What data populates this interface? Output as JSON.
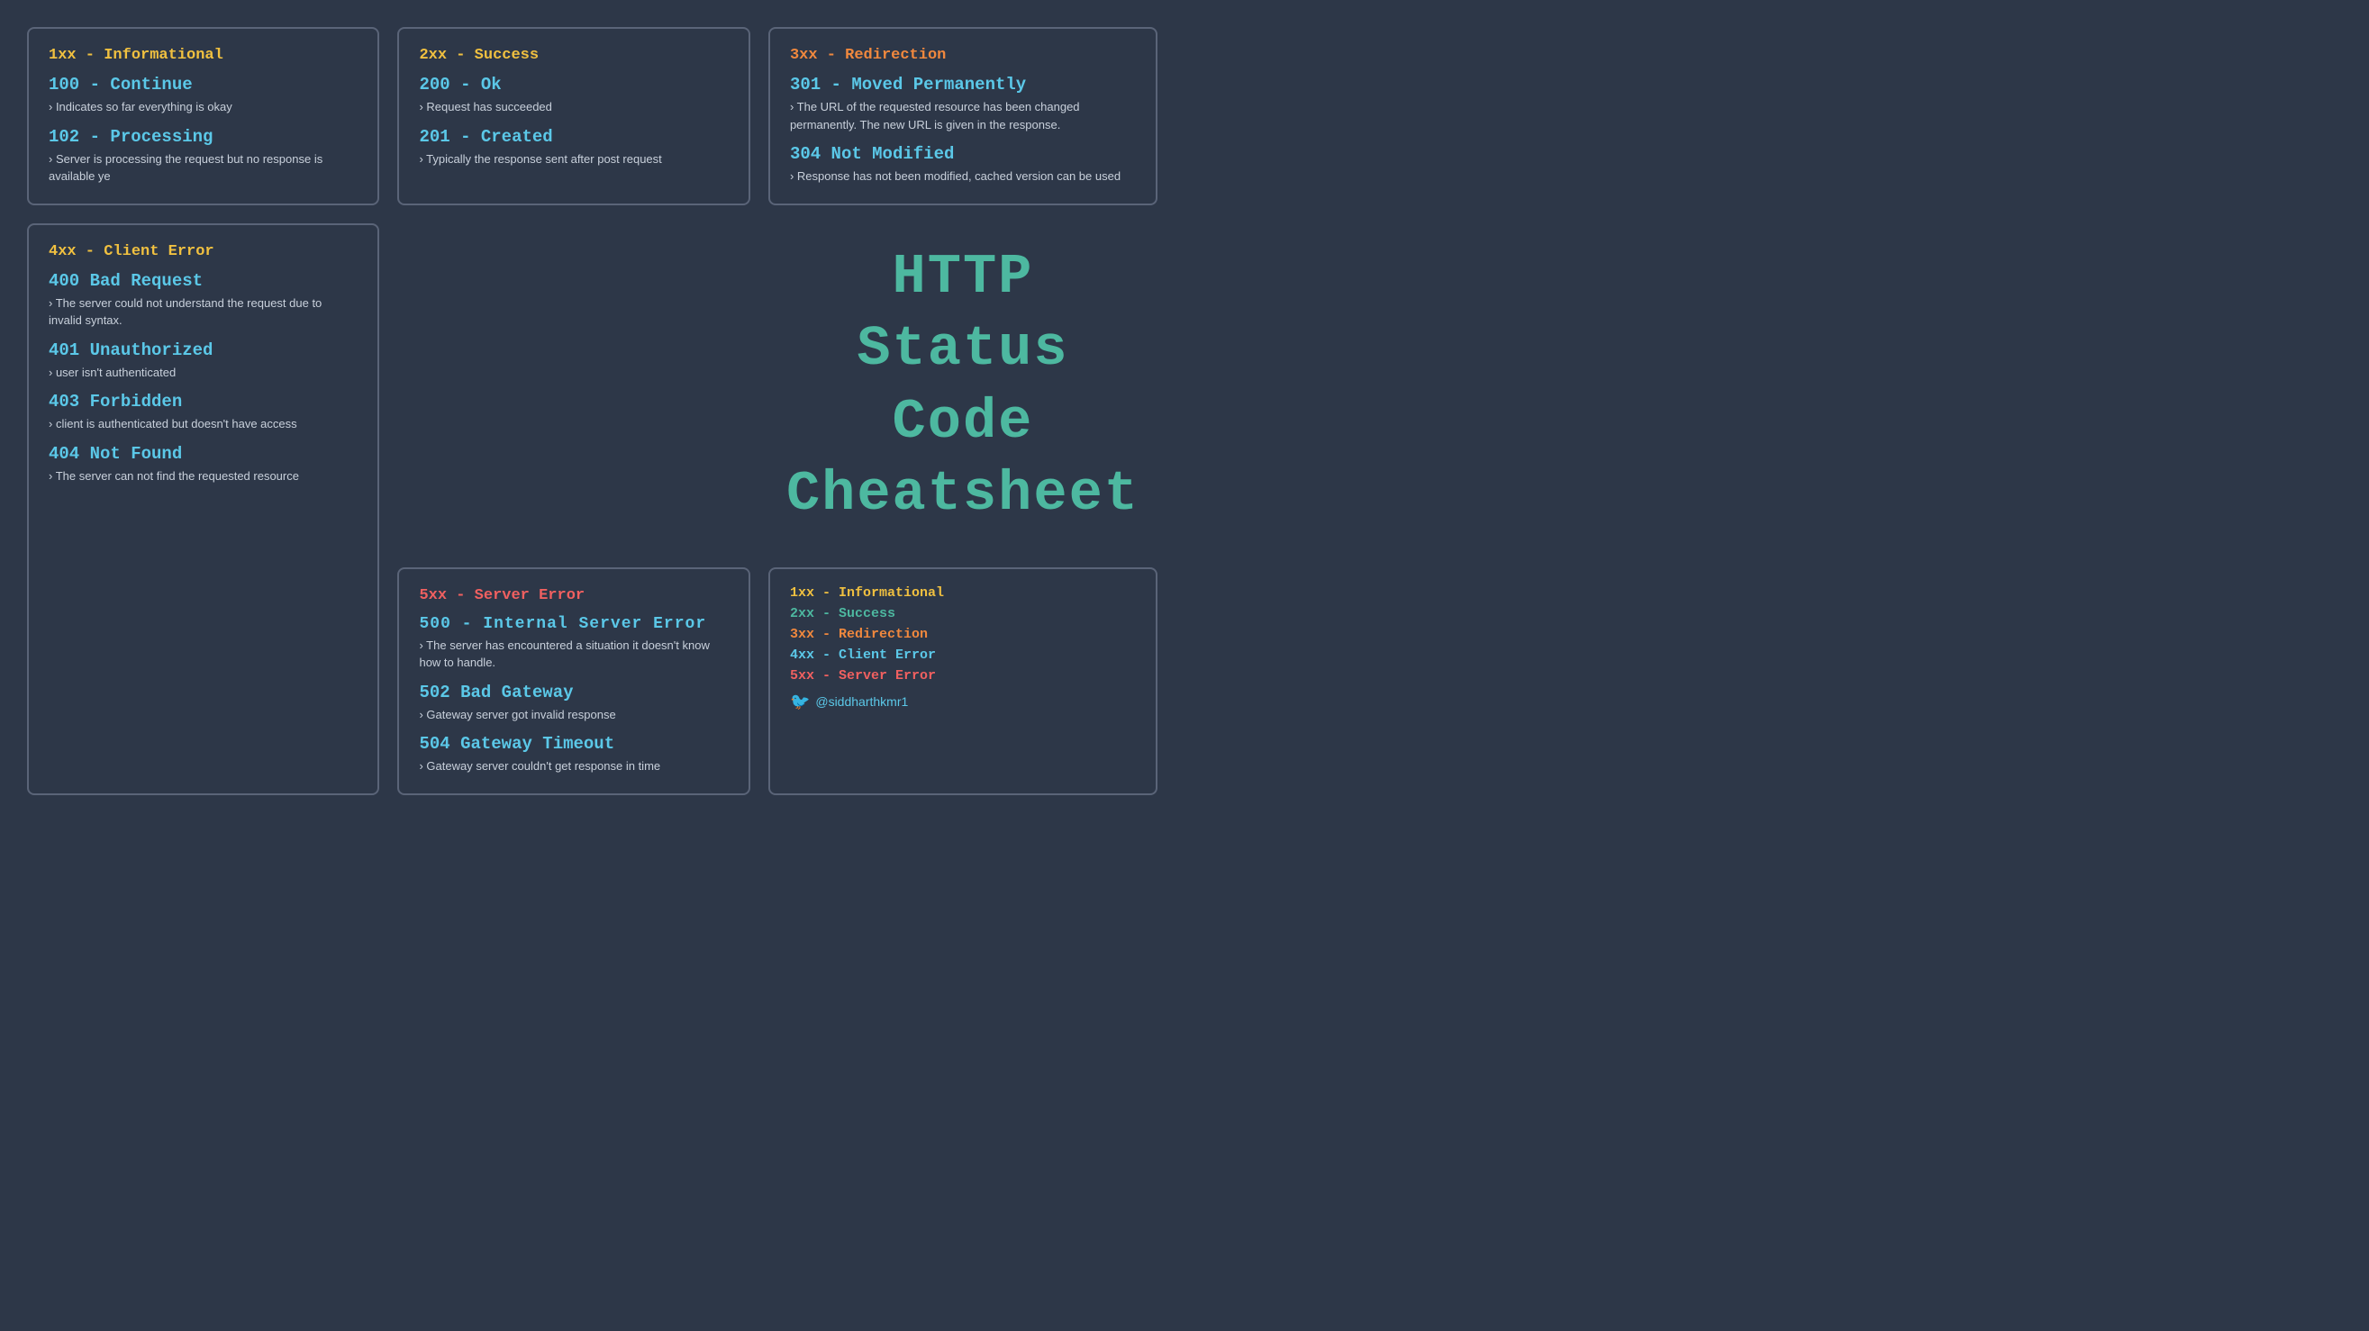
{
  "cards": {
    "1xx": {
      "category": "1xx - Informational",
      "items": [
        {
          "code": "100 - Continue",
          "desc": "› Indicates so far everything is okay"
        },
        {
          "code": "102 - Processing",
          "desc": "› Server is processing the request but no response is available ye"
        }
      ]
    },
    "2xx": {
      "category": "2xx - Success",
      "items": [
        {
          "code": "200 - Ok",
          "desc": "› Request has succeeded"
        },
        {
          "code": "201 - Created",
          "desc": "› Typically the response sent after post request"
        }
      ]
    },
    "3xx": {
      "category": "3xx - Redirection",
      "items": [
        {
          "code": "301 - Moved Permanently",
          "desc": "› The URL of the requested resource has been changed permanently. The new URL is given in the response."
        },
        {
          "code": "304 Not Modified",
          "desc": "› Response has not been modified, cached version can be used"
        }
      ]
    },
    "4xx": {
      "category": "4xx - Client Error",
      "items": [
        {
          "code": "400 Bad Request",
          "desc": "› The server could not understand the request due to invalid syntax."
        },
        {
          "code": "401 Unauthorized",
          "desc": "› user isn't authenticated"
        },
        {
          "code": "403 Forbidden",
          "desc": "› client is authenticated but doesn't have access"
        },
        {
          "code": "404 Not Found",
          "desc": "› The server can not find the requested resource"
        }
      ]
    },
    "5xx": {
      "category": "5xx - Server Error",
      "items": [
        {
          "code": "500 - Internal Server Error",
          "desc": "› The server has encountered a situation it doesn't know how to handle.",
          "mono": true
        },
        {
          "code": "502 Bad Gateway",
          "desc": "› Gateway server got invalid response",
          "mono": false
        },
        {
          "code": "504 Gateway Timeout",
          "desc": "› Gateway server couldn't get response in time",
          "mono": false
        }
      ]
    }
  },
  "title_line1": "HTTP Status Code",
  "title_line2": "Cheatsheet",
  "legend": {
    "items": [
      {
        "label": "1xx - Informational",
        "color": "yellow"
      },
      {
        "label": "2xx - Success",
        "color": "green"
      },
      {
        "label": "3xx - Redirection",
        "color": "orange"
      },
      {
        "label": "4xx - Client Error",
        "color": "blue"
      },
      {
        "label": "5xx - Server Error",
        "color": "red"
      }
    ],
    "twitter": "@siddharthkmr1"
  }
}
